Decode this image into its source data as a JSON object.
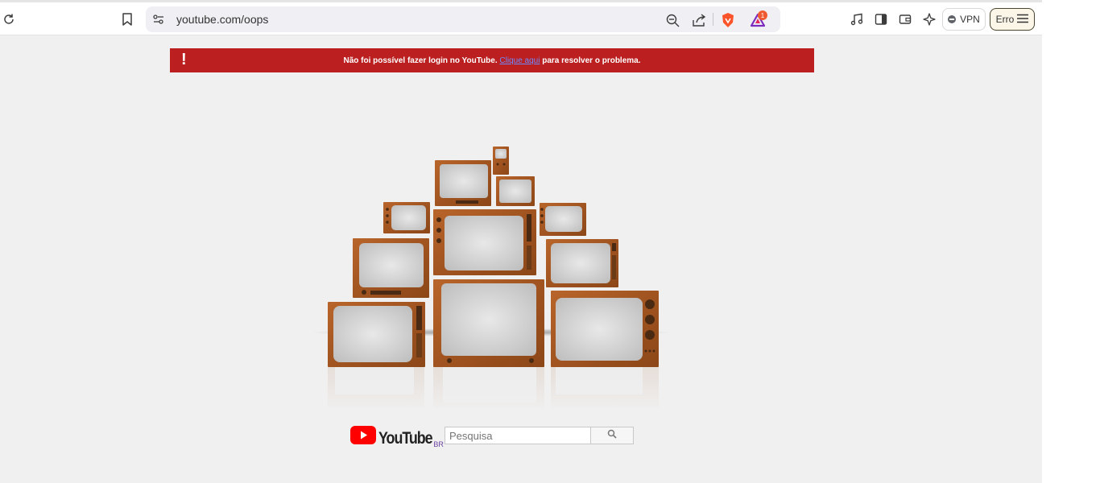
{
  "browser": {
    "url": "youtube.com/oops",
    "notification_count": "1",
    "vpn_label": "VPN",
    "error_label": "Erro",
    "brand_color": "#fb542b"
  },
  "alert": {
    "text_before": "Não foi possível fazer login no YouTube.",
    "link_text": "Clique aqui",
    "text_after": "para resolver o problema.",
    "icon": "!",
    "color": "#bb1f20"
  },
  "footer": {
    "logo_text": "YouTube",
    "region": "BR",
    "search_placeholder": "Pesquisa",
    "logo_color": "#ff0000"
  }
}
